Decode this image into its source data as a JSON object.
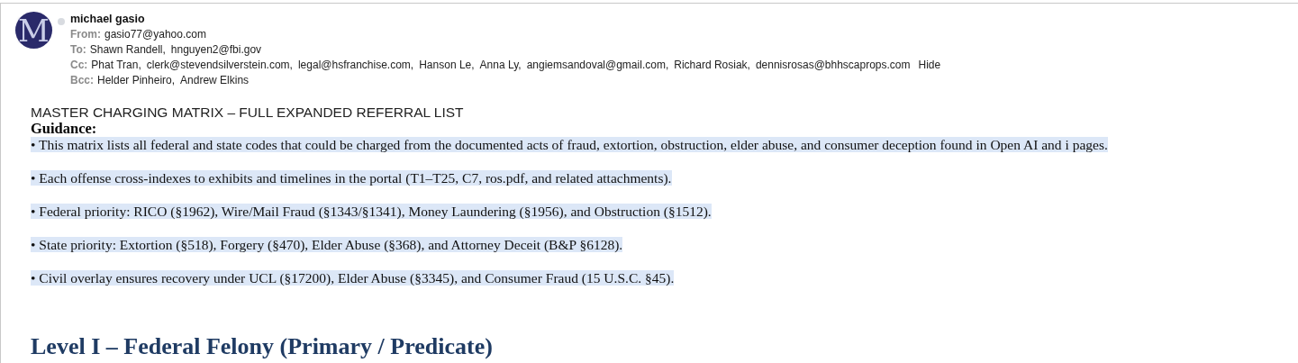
{
  "sender": {
    "avatar_initial": "M",
    "online": false,
    "name": "michael gasio"
  },
  "headers": [
    {
      "label": "From:",
      "values": [
        "gasio77@yahoo.com"
      ]
    },
    {
      "label": "To:",
      "values": [
        "Shawn Randell,",
        "hnguyen2@fbi.gov"
      ]
    },
    {
      "label": "Cc:",
      "values": [
        "Phat Tran,",
        "clerk@stevendsilverstein.com,",
        "legal@hsfranchise.com,",
        "Hanson Le,",
        "Anna Ly,",
        "angiemsandoval@gmail.com,",
        "Richard Rosiak,",
        "dennisrosas@bhhscaprops.com"
      ],
      "action": "Hide"
    },
    {
      "label": "Bcc:",
      "values": [
        "Helder Pinheiro,",
        "Andrew Elkins"
      ]
    }
  ],
  "body": {
    "title": "MASTER CHARGING MATRIX – FULL EXPANDED REFERRAL LIST",
    "guidance": "Guidance:",
    "bullets": [
      {
        "text": "• This matrix lists all federal and state codes that could be charged from the documented acts of fraud, extortion, obstruction, elder abuse, and consumer deception found in Open AI and i pages.",
        "highlighted": true
      },
      {
        "text": "• Each offense cross-indexes to exhibits and timelines in the portal (T1–T25, C7, ros.pdf, and related attachments).",
        "highlighted": true
      },
      {
        "text": "• Federal priority: RICO (§1962), Wire/Mail Fraud (§1343/§1341), Money Laundering (§1956), and Obstruction (§1512).",
        "highlighted": true
      },
      {
        "text": "• State priority: Extortion (§518), Forgery (§470), Elder Abuse (§368), and Attorney Deceit (B&P §6128).",
        "highlighted": true
      },
      {
        "text": "• Civil overlay ensures recovery under UCL (§17200), Elder Abuse (§3345), and Consumer Fraud (15 U.S.C. §45).",
        "highlighted": true
      }
    ],
    "section_heading": "Level I – Federal Felony (Primary / Predicate)"
  }
}
